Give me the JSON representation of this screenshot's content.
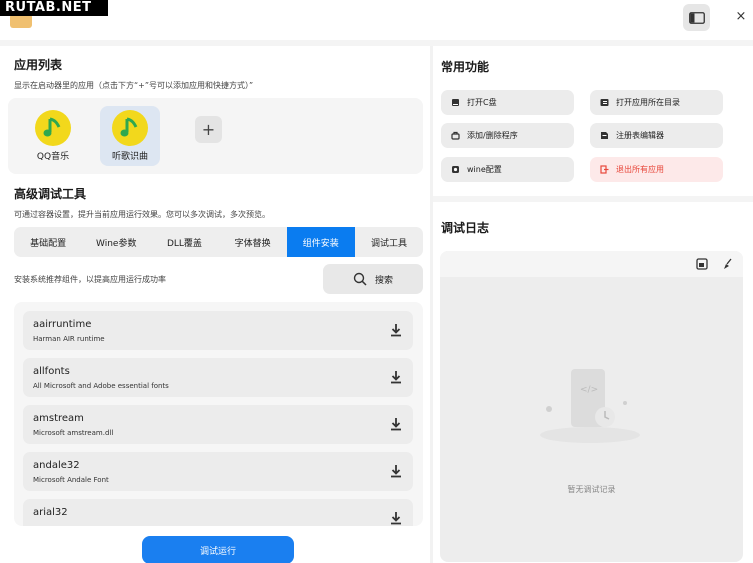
{
  "watermark": "RUTAB.NET",
  "titlebar": {
    "sidebar_toggle_icon": "sidebar-icon",
    "close_label": "×"
  },
  "app_list": {
    "title": "应用列表",
    "subtitle": "显示在启动器里的应用（点击下方“+”号可以添加应用和快捷方式）”",
    "apps": [
      {
        "label": "QQ音乐"
      },
      {
        "label": "听歌识曲"
      }
    ],
    "add_label": "+"
  },
  "debug_tools": {
    "title": "高级调试工具",
    "subtitle": "可通过容器设置，提升当前应用运行效果。您可以多次调试，多次预览。",
    "tabs": [
      "基础配置",
      "Wine参数",
      "DLL覆盖",
      "字体替换",
      "组件安装",
      "调试工具"
    ],
    "active_tab": "组件安装",
    "component_hint": "安装系统推荐组件，以提高应用运行成功率",
    "search_label": "搜索",
    "components": [
      {
        "name": "aairruntime",
        "desc": "Harman AIR runtime"
      },
      {
        "name": "allfonts",
        "desc": "All Microsoft and Adobe essential fonts"
      },
      {
        "name": "amstream",
        "desc": "Microsoft amstream.dll"
      },
      {
        "name": "andale32",
        "desc": "Microsoft Andale Font"
      },
      {
        "name": "arial32",
        "desc": ""
      }
    ],
    "run_label": "调试运行"
  },
  "common_functions": {
    "title": "常用功能",
    "buttons": [
      {
        "label": "打开C盘",
        "icon": "drive-icon"
      },
      {
        "label": "打开应用所在目录",
        "icon": "folder-icon"
      },
      {
        "label": "添加/删除程序",
        "icon": "package-icon"
      },
      {
        "label": "注册表编辑器",
        "icon": "registry-icon"
      },
      {
        "label": "wine配置",
        "icon": "wine-config-icon"
      },
      {
        "label": "退出所有应用",
        "icon": "exit-icon"
      }
    ],
    "danger_color": "#e8473b"
  },
  "debug_log": {
    "title": "调试日志",
    "empty_text": "暂无调试记录"
  },
  "colors": {
    "accent": "#0a7cf0",
    "app_icon": "#f2d81c"
  }
}
